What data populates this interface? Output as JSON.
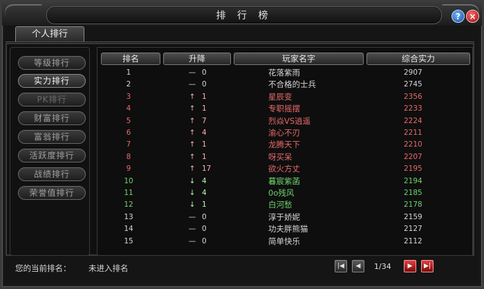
{
  "window": {
    "title": "排 行 榜"
  },
  "tabs": [
    {
      "label": "个人排行"
    }
  ],
  "categories": [
    {
      "label": "等级排行",
      "state": "normal"
    },
    {
      "label": "实力排行",
      "state": "active"
    },
    {
      "label": "PK排行",
      "state": "disabled"
    },
    {
      "label": "财富排行",
      "state": "normal"
    },
    {
      "label": "富翁排行",
      "state": "normal"
    },
    {
      "label": "活跃度排行",
      "state": "normal"
    },
    {
      "label": "战绩排行",
      "state": "normal"
    },
    {
      "label": "荣誉值排行",
      "state": "normal"
    }
  ],
  "table": {
    "headers": [
      "排名",
      "升降",
      "玩家名字",
      "综合实力"
    ],
    "rows": [
      {
        "rank": "1",
        "trend": "—",
        "change": "0",
        "name": "花落紫雨",
        "power": "2907",
        "color": "white"
      },
      {
        "rank": "2",
        "trend": "—",
        "change": "0",
        "name": "不合格的士兵",
        "power": "2745",
        "color": "white"
      },
      {
        "rank": "3",
        "trend": "↑",
        "change": "1",
        "name": "星辰变",
        "power": "2356",
        "color": "red"
      },
      {
        "rank": "4",
        "trend": "↑",
        "change": "1",
        "name": "专职摇摆",
        "power": "2233",
        "color": "red"
      },
      {
        "rank": "5",
        "trend": "↑",
        "change": "7",
        "name": "烈焱VS逍遥",
        "power": "2224",
        "color": "red"
      },
      {
        "rank": "6",
        "trend": "↑",
        "change": "4",
        "name": "渝心不刃",
        "power": "2211",
        "color": "red"
      },
      {
        "rank": "7",
        "trend": "↑",
        "change": "1",
        "name": "龙腾天下",
        "power": "2210",
        "color": "red"
      },
      {
        "rank": "8",
        "trend": "↑",
        "change": "1",
        "name": "呀买呆",
        "power": "2207",
        "color": "red"
      },
      {
        "rank": "9",
        "trend": "↑",
        "change": "17",
        "name": "欲火方丈",
        "power": "2195",
        "color": "red"
      },
      {
        "rank": "10",
        "trend": "↓",
        "change": "4",
        "name": "暮宸紫菡",
        "power": "2194",
        "color": "green"
      },
      {
        "rank": "11",
        "trend": "↓",
        "change": "4",
        "name": "0o残风",
        "power": "2185",
        "color": "green"
      },
      {
        "rank": "12",
        "trend": "↓",
        "change": "1",
        "name": "白河愁",
        "power": "2178",
        "color": "green"
      },
      {
        "rank": "13",
        "trend": "—",
        "change": "0",
        "name": "淳于娇妮",
        "power": "2159",
        "color": "white"
      },
      {
        "rank": "14",
        "trend": "—",
        "change": "0",
        "name": "功夫胖熊猫",
        "power": "2127",
        "color": "white"
      },
      {
        "rank": "15",
        "trend": "—",
        "change": "0",
        "name": "简单快乐",
        "power": "2112",
        "color": "white"
      }
    ]
  },
  "footer": {
    "current_rank_label": "您的当前排名：",
    "current_rank_value": "未进入排名",
    "page": "1/34"
  },
  "colors": {
    "up": "#e86a6a",
    "down": "#6ed36e",
    "same": "#d6d6d6"
  },
  "icons": {
    "help": "question-icon",
    "close": "close-icon",
    "first": "first-page-icon",
    "prev": "prev-page-icon",
    "next": "next-page-icon",
    "last": "last-page-icon"
  }
}
